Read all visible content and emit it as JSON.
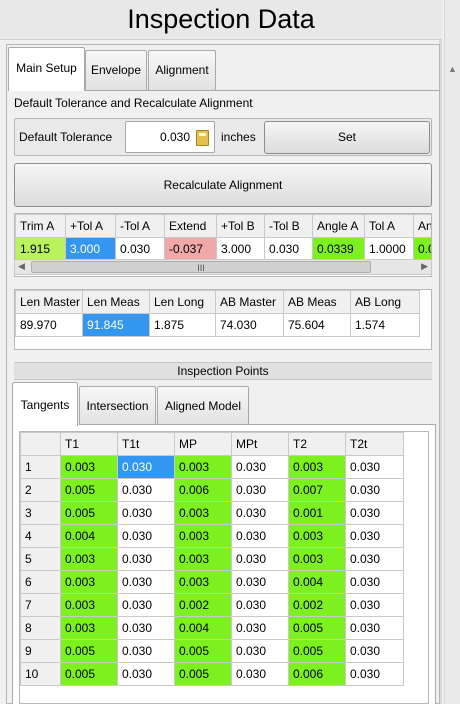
{
  "window": {
    "title": "Inspection Data"
  },
  "main_tabs": [
    {
      "label": "Main Setup"
    },
    {
      "label": "Envelope"
    },
    {
      "label": "Alignment"
    }
  ],
  "setup": {
    "section_label": "Default Tolerance and Recalculate Alignment",
    "tolerance_label": "Default Tolerance",
    "tolerance_value": "0.030",
    "units_label": "inches",
    "set_button": "Set",
    "recalc_button": "Recalculate Alignment"
  },
  "trim_grid": {
    "headers": [
      "Trim A",
      "+Tol A",
      "-Tol A",
      "Extend",
      "+Tol B",
      "-Tol B",
      "Angle A",
      "Tol A",
      "An"
    ],
    "row": [
      "1.915",
      "3.000",
      "0.030",
      "-0.037",
      "3.000",
      "0.030",
      "0.0339",
      "1.0000",
      "0.0"
    ],
    "cell_colors": {
      "green": "#7df01f",
      "light_green": "#b9f25d",
      "blue": "#3397f2",
      "red": "#f0a8a8"
    },
    "scroll_grip": "III"
  },
  "len_grid": {
    "headers": [
      "Len Master",
      "Len Meas",
      "Len Long",
      "AB Master",
      "AB Meas",
      "AB Long"
    ],
    "row": [
      "89.970",
      "91.845",
      "1.875",
      "74.030",
      "75.604",
      "1.574"
    ]
  },
  "inspection_points": {
    "title": "Inspection Points",
    "tabs": [
      {
        "label": "Tangents"
      },
      {
        "label": "Intersection"
      },
      {
        "label": "Aligned Model"
      }
    ],
    "headers": [
      "T1",
      "T1t",
      "MP",
      "MPt",
      "T2",
      "T2t"
    ],
    "rows": [
      {
        "index": "1",
        "cells": [
          "0.003",
          "0.030",
          "0.003",
          "0.030",
          "0.003",
          "0.030"
        ]
      },
      {
        "index": "2",
        "cells": [
          "0.005",
          "0.030",
          "0.006",
          "0.030",
          "0.007",
          "0.030"
        ]
      },
      {
        "index": "3",
        "cells": [
          "0.005",
          "0.030",
          "0.003",
          "0.030",
          "0.001",
          "0.030"
        ]
      },
      {
        "index": "4",
        "cells": [
          "0.004",
          "0.030",
          "0.003",
          "0.030",
          "0.003",
          "0.030"
        ]
      },
      {
        "index": "5",
        "cells": [
          "0.003",
          "0.030",
          "0.003",
          "0.030",
          "0.003",
          "0.030"
        ]
      },
      {
        "index": "6",
        "cells": [
          "0.003",
          "0.030",
          "0.003",
          "0.030",
          "0.004",
          "0.030"
        ]
      },
      {
        "index": "7",
        "cells": [
          "0.003",
          "0.030",
          "0.002",
          "0.030",
          "0.002",
          "0.030"
        ]
      },
      {
        "index": "8",
        "cells": [
          "0.003",
          "0.030",
          "0.004",
          "0.030",
          "0.005",
          "0.030"
        ]
      },
      {
        "index": "9",
        "cells": [
          "0.005",
          "0.030",
          "0.005",
          "0.030",
          "0.005",
          "0.030"
        ]
      },
      {
        "index": "10",
        "cells": [
          "0.005",
          "0.030",
          "0.005",
          "0.030",
          "0.006",
          "0.030"
        ]
      }
    ]
  }
}
